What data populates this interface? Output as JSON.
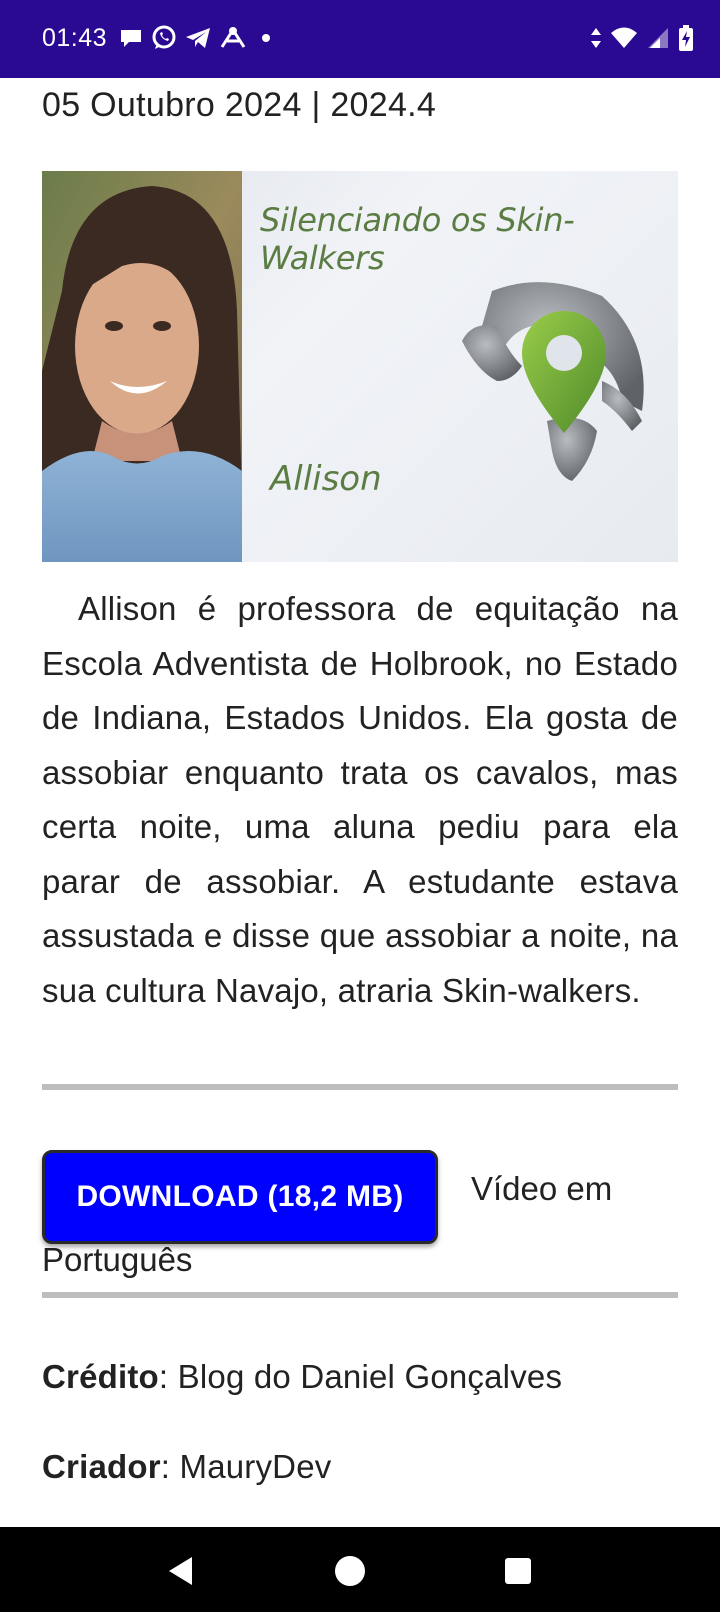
{
  "status_bar": {
    "time": "01:43",
    "notification_icons": [
      "chat-bubble-icon",
      "whatsapp-icon",
      "telegram-icon",
      "network-icon"
    ],
    "right_icons": [
      "data-arrows-icon",
      "wifi-icon",
      "signal-icon",
      "battery-charging-icon"
    ],
    "background": "#2a0a93"
  },
  "article": {
    "dateline": "05 Outubro 2024 | 2024.4",
    "banner": {
      "title": "Silenciando os Skin-Walkers",
      "name": "Allison",
      "accent_color": "#5b7d44"
    },
    "paragraph": "Allison é professora de equitação na Escola Adventista de Holbrook, no Estado de Indiana, Estados Unidos. Ela gosta de assobiar enquanto trata os cavalos, mas certa noite, uma aluna pediu para ela parar de assobiar. A estudante estava assustada e disse que assobiar a noite, na sua cultura Navajo, atraria Skin-walkers.",
    "download_button": {
      "label": "DOWNLOAD (18,2 MB)",
      "color": "#0000ff"
    },
    "video_label_part1": "Vídeo em",
    "video_label_part2": "Português",
    "credit": {
      "label": "Crédito",
      "value": ": Blog do Daniel Gonçalves"
    },
    "creator": {
      "label": "Criador",
      "value": ": MauryDev"
    }
  },
  "nav_bar": {
    "buttons": [
      "back-icon",
      "home-icon",
      "recents-icon"
    ]
  }
}
